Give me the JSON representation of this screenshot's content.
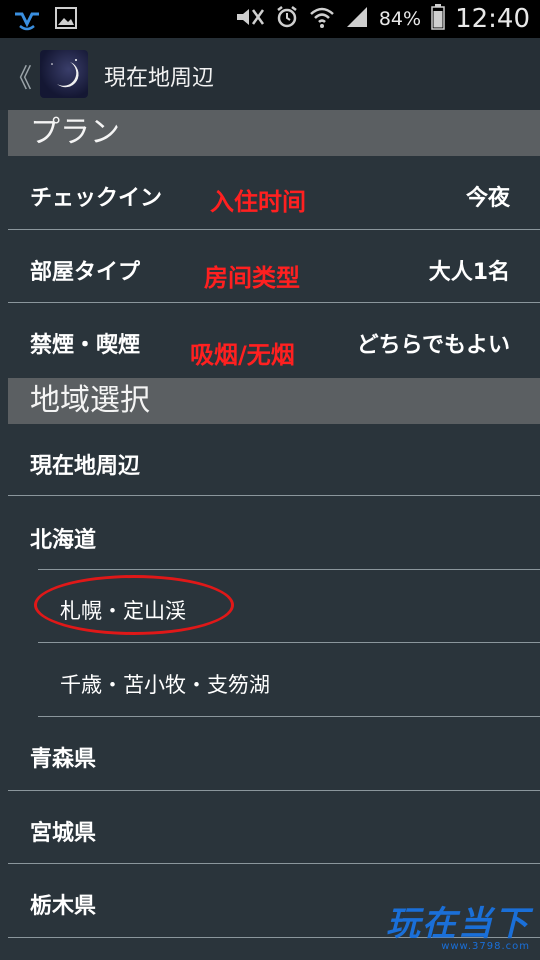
{
  "status_bar": {
    "battery_percent": "84%",
    "time": "12:40",
    "icons": [
      "app-notification-icon",
      "image-icon",
      "mute-icon",
      "alarm-icon",
      "wifi-icon",
      "signal-icon",
      "battery-icon"
    ]
  },
  "action_bar": {
    "title": "現在地周辺",
    "back_glyph": "《"
  },
  "sections": {
    "plan_header": "プラン",
    "region_header": "地域選択"
  },
  "plan_rows": [
    {
      "label": "チェックイン",
      "value": "今夜",
      "annotation": "入住时间"
    },
    {
      "label": "部屋タイプ",
      "value": "大人1名",
      "annotation": "房间类型"
    },
    {
      "label": "禁煙・喫煙",
      "value": "どちらでもよい",
      "annotation": "吸烟/无烟"
    }
  ],
  "region_rows": [
    {
      "label": "現在地周辺"
    },
    {
      "label": "北海道"
    },
    {
      "label": "札幌・定山渓"
    },
    {
      "label": "千歳・苫小牧・支笏湖"
    },
    {
      "label": "青森県"
    },
    {
      "label": "宮城県"
    },
    {
      "label": "栃木県"
    }
  ],
  "watermark": {
    "main": "玩在当下",
    "sub": "www.3798.com"
  },
  "colors": {
    "background": "#2a343b",
    "section_header": "#5b5f62",
    "annotation_red": "#ff2020"
  }
}
